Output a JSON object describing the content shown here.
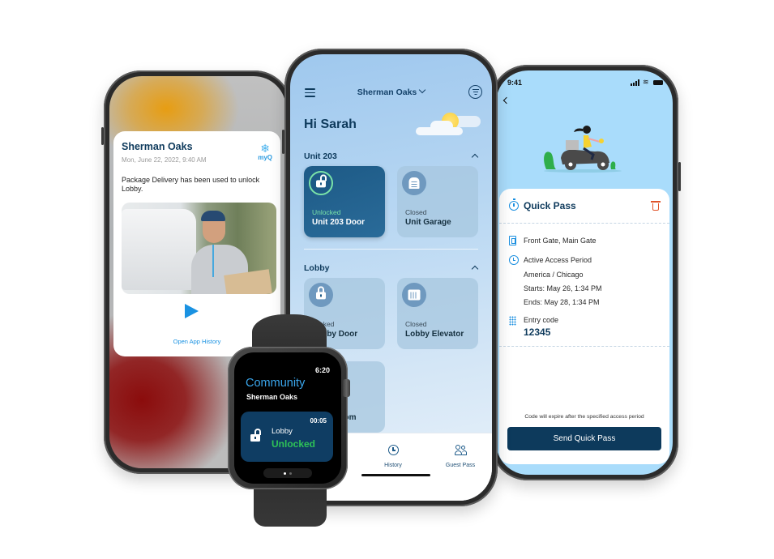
{
  "left_phone": {
    "notification": {
      "title": "Sherman Oaks",
      "date": "Mon, June 22, 2022, 9:40 AM",
      "brand_icon": "snowflake-icon",
      "brand": "myQ",
      "body": "Package Delivery has been used to unlock Lobby.",
      "photo_alt": "Delivery person holding packages in front of a van",
      "play_icon": "play-icon",
      "link": "Open App History"
    }
  },
  "middle_phone": {
    "menu_icon": "hamburger-icon",
    "location": "Sherman Oaks",
    "filter_icon": "filter-icon",
    "greeting": "Hi Sarah",
    "weather_icon": "partly-cloudy-icon",
    "sections": [
      {
        "title": "Unit 203",
        "devices": [
          {
            "status": "Unlocked",
            "name": "Unit 203 Door",
            "icon": "unlocked-icon",
            "active": true
          },
          {
            "status": "Closed",
            "name": "Unit Garage",
            "icon": "garage-icon",
            "active": false
          }
        ]
      },
      {
        "title": "Lobby",
        "devices": [
          {
            "status": "Locked",
            "name": "Lobby Door",
            "icon": "lock-icon",
            "active": false
          },
          {
            "status": "Closed",
            "name": "Lobby Elevator",
            "icon": "elevator-icon",
            "active": false
          },
          {
            "status": "",
            "name": "Mail Room",
            "icon": "",
            "active": false
          }
        ]
      }
    ],
    "bottom_nav": [
      {
        "label": "History",
        "icon": "clock-icon"
      },
      {
        "label": "Guest Pass",
        "icon": "people-icon"
      }
    ]
  },
  "right_phone": {
    "status_bar": {
      "time": "9:41"
    },
    "quick_pass": {
      "title": "Quick Pass",
      "gates": "Front Gate, Main Gate",
      "access_period_label": "Active Access Period",
      "timezone": "America / Chicago",
      "starts": "Starts: May 26, 1:34 PM",
      "ends": "Ends: May 28, 1:34 PM",
      "entry_code_label": "Entry code",
      "entry_code": "12345",
      "note": "Code will expire after the specified access period",
      "send_button": "Send Quick Pass"
    }
  },
  "watch": {
    "time": "6:20",
    "title": "Community",
    "subtitle": "Sherman Oaks",
    "timer": "00:05",
    "door": "Lobby",
    "state": "Unlocked",
    "page_count": 2,
    "current_page": 1
  },
  "colors": {
    "navy": "#0e3a5c",
    "accent_blue": "#1a8fe0",
    "unlocked_green": "#2ec257",
    "delete_red": "#e0542a"
  }
}
